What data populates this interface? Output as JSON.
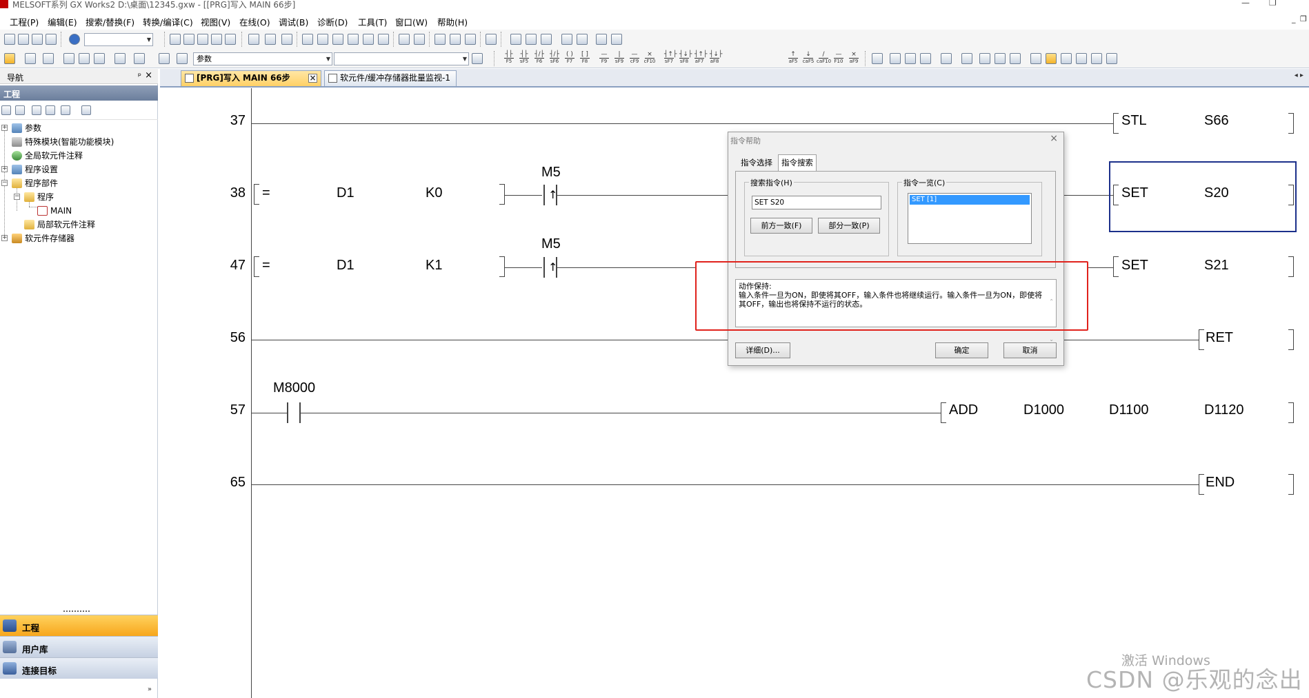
{
  "window": {
    "title": "MELSOFT系列 GX Works2 D:\\桌面\\12345.gxw - [[PRG]写入 MAIN 66步]"
  },
  "menu": [
    "工程(P)",
    "编辑(E)",
    "搜索/替换(F)",
    "转换/编译(C)",
    "视图(V)",
    "在线(O)",
    "调试(B)",
    "诊断(D)",
    "工具(T)",
    "窗口(W)",
    "帮助(H)"
  ],
  "toolbar": {
    "search_combo_value": "参数",
    "fkeys": [
      "F5",
      "sF5",
      "F6",
      "sF6",
      "F7",
      "F8",
      "F9",
      "sF9",
      "cF9",
      "cF10",
      "sF7",
      "sF8",
      "aF7",
      "aF8",
      "aF5",
      "caF5",
      "caF10",
      "F10",
      "aF9"
    ]
  },
  "nav": {
    "header": "导航",
    "caption": "工程",
    "tree": [
      {
        "label": "参数"
      },
      {
        "label": "特殊模块(智能功能模块)"
      },
      {
        "label": "全局软元件注释"
      },
      {
        "label": "程序设置"
      },
      {
        "label": "程序部件"
      },
      {
        "label": "程序"
      },
      {
        "label": "MAIN"
      },
      {
        "label": "局部软元件注释"
      },
      {
        "label": "软元件存储器"
      }
    ],
    "bottom": [
      {
        "label": "工程",
        "active": true
      },
      {
        "label": "用户库",
        "active": false
      },
      {
        "label": "连接目标",
        "active": false
      }
    ]
  },
  "tabs": [
    {
      "label": "[PRG]写入 MAIN 66步",
      "active": true
    },
    {
      "label": "软元件/缓冲存储器批量监视-1",
      "active": false
    }
  ],
  "ladder": {
    "rows": [
      {
        "step": "37",
        "instr": "STL",
        "ops": [
          "S66"
        ]
      },
      {
        "step": "38",
        "cmp": "=",
        "d": "D1",
        "k": "K0",
        "contact": "M5",
        "instr": "SET",
        "ops": [
          "S20"
        ]
      },
      {
        "step": "47",
        "cmp": "=",
        "d": "D1",
        "k": "K1",
        "contact": "M5",
        "instr": "SET",
        "ops": [
          "S21"
        ]
      },
      {
        "step": "56",
        "instr": "RET",
        "ops": []
      },
      {
        "step": "57",
        "contact": "M8000",
        "instr": "ADD",
        "ops": [
          "D1000",
          "D1100",
          "D1120"
        ]
      },
      {
        "step": "65",
        "instr": "END",
        "ops": []
      }
    ]
  },
  "dialog": {
    "title": "指令帮助",
    "tabs": [
      "指令选择",
      "指令搜索"
    ],
    "search_label": "搜索指令(H)",
    "search_value": "SET S20",
    "btn_forward": "前方一致(F)",
    "btn_partial": "部分一致(P)",
    "list_label": "指令一览(C)",
    "list_items": [
      "SET [1]"
    ],
    "description_title": "动作保持:",
    "description": "输入条件一旦为ON，即使将其OFF，输入条件也将继续运行。输入条件一旦为ON，即使将其OFF，输出也将保持不运行的状态。",
    "btn_detail": "详细(D)...",
    "btn_ok": "确定",
    "btn_cancel": "取消"
  },
  "watermark": {
    "activate": "激活 Windows",
    "csdn": "CSDN @乐观的念出"
  },
  "colors": {
    "highlight_red": "#e0211b",
    "cursor_blue": "#1b2f8a",
    "nav_active": "#f7a61c",
    "list_selection": "#3399ff"
  }
}
